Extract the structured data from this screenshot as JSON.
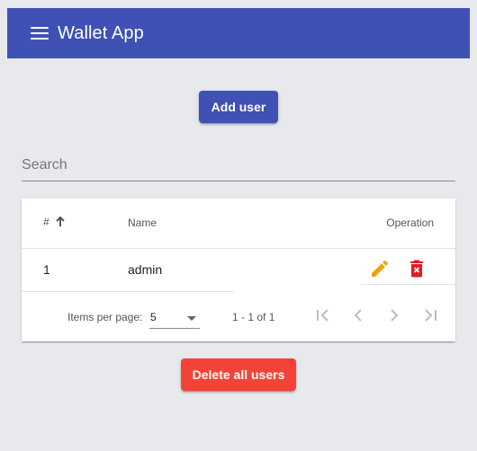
{
  "app": {
    "title": "Wallet App"
  },
  "actions": {
    "add_user": "Add user",
    "delete_all": "Delete all users"
  },
  "search": {
    "placeholder": "Search",
    "value": ""
  },
  "table": {
    "columns": {
      "number": "#",
      "name": "Name",
      "operation": "Operation"
    },
    "sort": {
      "column": "number",
      "direction": "ascending"
    },
    "rows": [
      {
        "id": "1",
        "name": "admin"
      }
    ]
  },
  "paginator": {
    "items_per_page_label": "Items per page:",
    "items_per_page_value": "5",
    "range_label": "1 - 1 of 1"
  },
  "colors": {
    "primary": "#3f51b5",
    "warn": "#f44336",
    "edit_icon": "#f0a30a",
    "delete_icon": "#e01b24",
    "background": "#e7e9ed"
  },
  "icons": {
    "menu": "menu-icon",
    "sort": "arrow-up-icon",
    "edit": "pencil-icon",
    "delete": "trash-icon",
    "first_page": "first-page-icon",
    "prev_page": "chevron-left-icon",
    "next_page": "chevron-right-icon",
    "last_page": "last-page-icon"
  }
}
